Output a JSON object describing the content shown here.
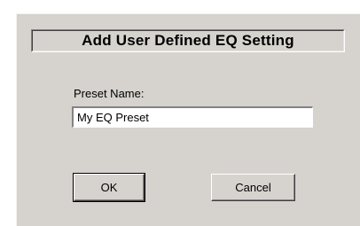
{
  "dialog": {
    "title": "Add User Defined EQ Setting",
    "preset_label": "Preset Name:",
    "preset_value": "My EQ Preset",
    "ok_label": "OK",
    "cancel_label": "Cancel"
  },
  "colors": {
    "dialog_background": "#d6d3ce",
    "input_background": "#ffffff"
  }
}
